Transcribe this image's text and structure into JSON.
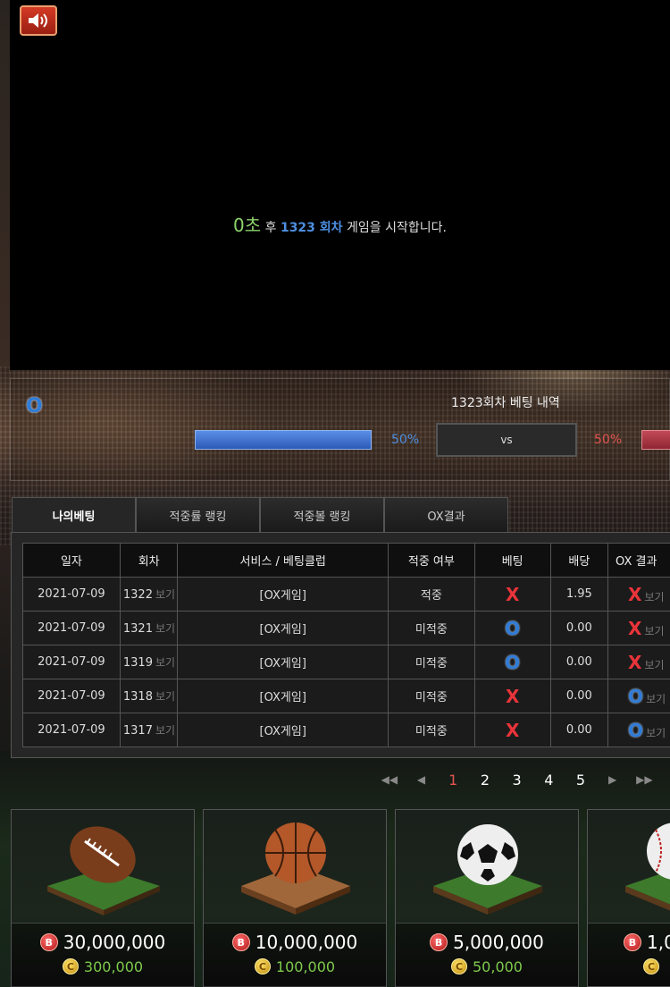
{
  "player": {
    "countdown_sec": "0초",
    "countdown_after": "후",
    "round": "1323 회차",
    "message": "게임을 시작합니다."
  },
  "bet_status": {
    "o_label": "O",
    "title": "1323회차 베팅 내역",
    "o_percent": "50%",
    "x_percent": "50%",
    "o_fill": 1.0,
    "vs_label": "vs"
  },
  "tabs": [
    {
      "label": "나의베팅",
      "active": true
    },
    {
      "label": "적중률 랭킹",
      "active": false
    },
    {
      "label": "적중볼 랭킹",
      "active": false
    },
    {
      "label": "OX결과",
      "active": false
    }
  ],
  "table": {
    "headers": [
      "일자",
      "회차",
      "서비스 / 베팅클럽",
      "적중 여부",
      "베팅",
      "배당",
      "OX 결과"
    ],
    "view_label": "보기",
    "rows": [
      {
        "date": "2021-07-09",
        "round": "1322",
        "service": "[OX게임]",
        "hit": "적중",
        "bet": "X",
        "odds": "1.95",
        "result": "X"
      },
      {
        "date": "2021-07-09",
        "round": "1321",
        "service": "[OX게임]",
        "hit": "미적중",
        "bet": "O",
        "odds": "0.00",
        "result": "X"
      },
      {
        "date": "2021-07-09",
        "round": "1319",
        "service": "[OX게임]",
        "hit": "미적중",
        "bet": "O",
        "odds": "0.00",
        "result": "X"
      },
      {
        "date": "2021-07-09",
        "round": "1318",
        "service": "[OX게임]",
        "hit": "미적중",
        "bet": "X",
        "odds": "0.00",
        "result": "O"
      },
      {
        "date": "2021-07-09",
        "round": "1317",
        "service": "[OX게임]",
        "hit": "미적중",
        "bet": "X",
        "odds": "0.00",
        "result": "O"
      }
    ]
  },
  "pager": {
    "first": "◀◀",
    "prev": "◀",
    "pages": [
      "1",
      "2",
      "3",
      "4",
      "5"
    ],
    "current": "1",
    "next": "▶",
    "last": "▶▶"
  },
  "products": [
    {
      "name": "football",
      "price_b": "30,000,000",
      "price_c": "300,000"
    },
    {
      "name": "basketball",
      "price_b": "10,000,000",
      "price_c": "100,000"
    },
    {
      "name": "soccer-ball",
      "price_b": "5,000,000",
      "price_c": "50,000"
    },
    {
      "name": "baseball",
      "price_b": "1,0",
      "price_c": ""
    }
  ],
  "coins": {
    "b": "B",
    "c": "C"
  },
  "colors": {
    "o_blue": "#2f7cd8",
    "x_red": "#e8343a",
    "countdown_green": "#8cd36b",
    "coin_green": "#7ecb4c"
  }
}
